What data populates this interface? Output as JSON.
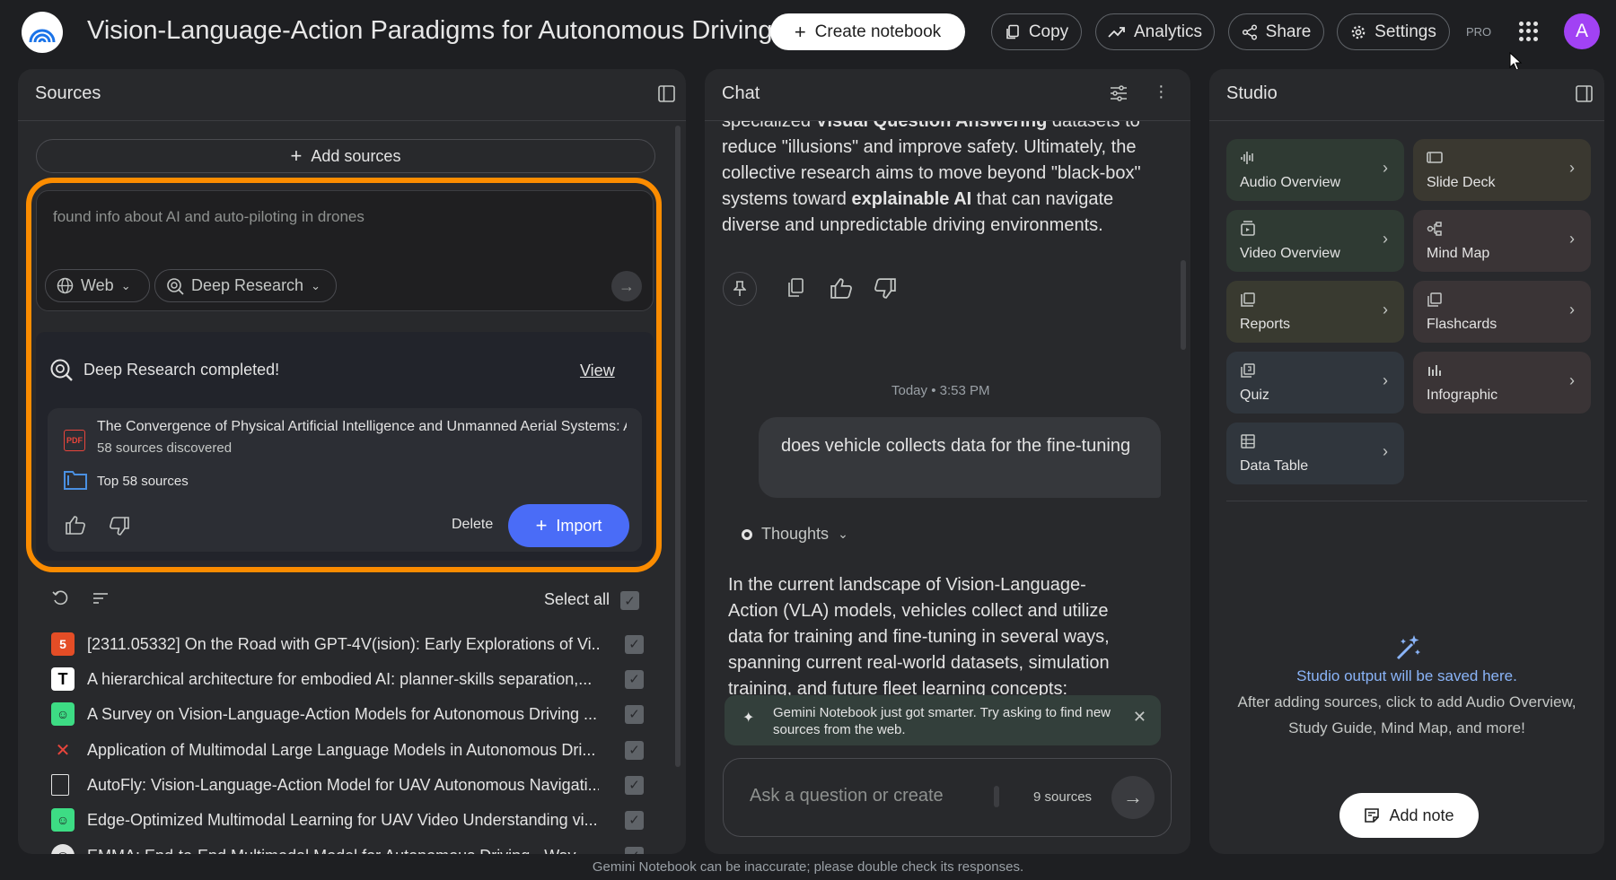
{
  "header": {
    "title": "Vision-Language-Action Paradigms for Autonomous Driving",
    "create_notebook": "Create notebook",
    "copy": "Copy",
    "analytics": "Analytics",
    "share": "Share",
    "settings": "Settings",
    "pro_badge": "PRO",
    "avatar_letter": "A"
  },
  "sources": {
    "title": "Sources",
    "add_sources": "Add sources",
    "search_placeholder": "found info about AI and auto-piloting in drones",
    "web_chip": "Web",
    "deep_research_chip": "Deep Research",
    "dr_status": "Deep Research completed!",
    "view_link": "View",
    "result_title": "The Convergence of Physical Artificial Intelligence and Unmanned Aerial Systems: A",
    "result_subtitle": "58 sources discovered",
    "top_sources": "Top 58 sources",
    "delete": "Delete",
    "import": "Import",
    "select_all": "Select all",
    "items": [
      {
        "label": "[2311.05332] On the Road with GPT-4V(ision): Early Explorations of Vi...",
        "icon": "html5-icon"
      },
      {
        "label": "A hierarchical architecture for embodied AI: planner-skills separation,...",
        "icon": "text-icon"
      },
      {
        "label": "A Survey on Vision-Language-Action Models for Autonomous Driving ...",
        "icon": "smiley-icon"
      },
      {
        "label": "Application of Multimodal Large Language Models in Autonomous Dri...",
        "icon": "x-icon"
      },
      {
        "label": "AutoFly: Vision-Language-Action Model for UAV Autonomous Navigati...",
        "icon": "doc-icon"
      },
      {
        "label": "Edge-Optimized Multimodal Learning for UAV Video Understanding vi...",
        "icon": "smiley-icon"
      },
      {
        "label": "EMMA: End-to-End Multimodal Model for Autonomous Driving - Way...",
        "icon": "globe-icon"
      }
    ]
  },
  "chat": {
    "title": "Chat",
    "para_line0_a": "specialized ",
    "para_line0_b": "Visual Question Answering",
    "para_line0_c": " datasets to",
    "para_line1": "reduce \"illusions\" and improve safety. Ultimately, the",
    "para_line2": "collective research aims to move beyond \"black-box\"",
    "para_line3_a": "systems toward ",
    "para_line3_b": "explainable AI",
    "para_line3_c": " that can navigate",
    "para_line4": "diverse and unpredictable driving environments.",
    "timestamp": "Today • 3:53 PM",
    "user_message": "does vehicle collects data for the fine-tuning",
    "thoughts": "Thoughts",
    "answer_lines": [
      "In the current landscape of Vision-Language-",
      "Action (VLA) models, vehicles collect and utilize",
      "data for training and fine-tuning in several ways,",
      "spanning current real-world datasets, simulation",
      "training, and future fleet learning concepts:"
    ],
    "toast": "Gemini Notebook just got smarter. Try asking to find new sources from the web.",
    "ask_placeholder": "Ask a question or create",
    "sources_count": "9 sources"
  },
  "studio": {
    "title": "Studio",
    "tiles": [
      {
        "label": "Audio Overview",
        "color": "#2f3a33"
      },
      {
        "label": "Slide Deck",
        "color": "#3a3830"
      },
      {
        "label": "Video Overview",
        "color": "#2f3a33"
      },
      {
        "label": "Mind Map",
        "color": "#3a3436"
      },
      {
        "label": "Reports",
        "color": "#393a30"
      },
      {
        "label": "Flashcards",
        "color": "#3a3436"
      },
      {
        "label": "Quiz",
        "color": "#30363d"
      },
      {
        "label": "Infographic",
        "color": "#3a3436"
      },
      {
        "label": "Data Table",
        "color": "#30363d"
      }
    ],
    "empty_title": "Studio output will be saved here.",
    "empty_line1": "After adding sources, click to add Audio Overview,",
    "empty_line2": "Study Guide, Mind Map, and more!",
    "add_note": "Add note"
  },
  "footer": "Gemini Notebook can be inaccurate; please double check its responses."
}
